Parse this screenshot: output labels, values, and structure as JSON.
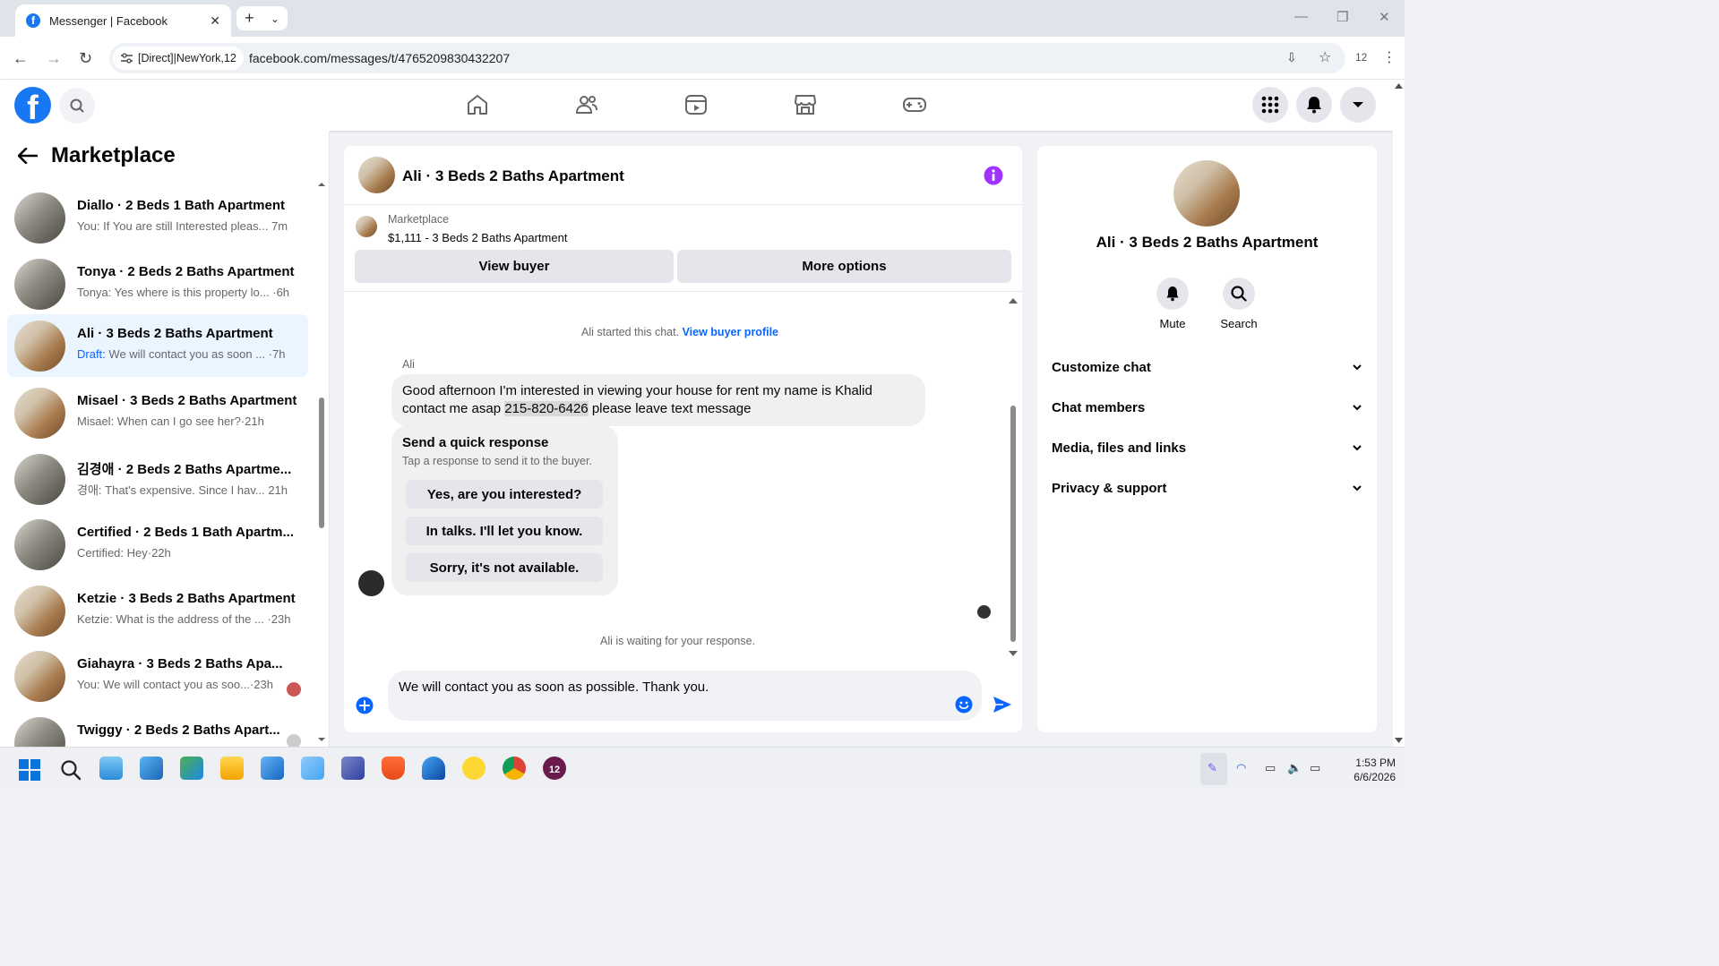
{
  "browser": {
    "tab_title": "Messenger | Facebook",
    "site_chip": "[Direct]|NewYork,12",
    "url": "facebook.com/messages/t/4765209830432207",
    "extension_count": "12"
  },
  "fb_header": {
    "logo": "f",
    "nav_icons": [
      "home-icon",
      "friends-icon",
      "video-icon",
      "marketplace-icon",
      "gaming-icon"
    ],
    "right_icons": [
      "menu-grid-icon",
      "notifications-bell-icon",
      "account-caret-icon"
    ]
  },
  "sidebar": {
    "title": "Marketplace",
    "conversations": [
      {
        "name": "Diallo · 2 Beds 1 Bath Apartment",
        "preview": "You: If You are still Interested pleas...",
        "time": "7m",
        "active": false
      },
      {
        "name": "Tonya · 2 Beds 2 Baths Apartment",
        "preview": "Tonya: Yes where is this property lo...",
        "time": "·6h",
        "active": false
      },
      {
        "name": "Ali · 3 Beds 2 Baths Apartment",
        "draft_label": "Draft:",
        "preview": " We will contact you as soon ...",
        "time": "·7h",
        "active": true
      },
      {
        "name": "Misael · 3 Beds 2 Baths Apartment",
        "preview": "Misael: When can I go see her?",
        "time": "·21h",
        "active": false
      },
      {
        "name": "김경애 · 2 Beds 2 Baths Apartme...",
        "preview": "경애: That's expensive. Since I hav...",
        "time": "21h",
        "active": false
      },
      {
        "name": "Certified · 2 Beds 1 Bath Apartm...",
        "preview": "Certified: Hey",
        "time": "·22h",
        "active": false
      },
      {
        "name": "Ketzie · 3 Beds 2 Baths Apartment",
        "preview": "Ketzie: What is the address of the ...",
        "time": "·23h",
        "active": false
      },
      {
        "name": "Giahayra · 3 Beds 2 Baths Apa...",
        "preview": "You: We will contact you as soo...",
        "time": "·23h",
        "active": false
      },
      {
        "name": "Twiggy · 2 Beds 2 Baths Apart...",
        "preview": "",
        "time": "",
        "active": false
      }
    ]
  },
  "chat": {
    "name": "Ali · 3 Beds 2 Baths Apartment",
    "marketplace_label": "Marketplace",
    "listing": "$1,111 - 3 Beds 2 Baths Apartment",
    "view_buyer": "View buyer",
    "more_options": "More options",
    "started_text": "Ali started this chat.",
    "view_buyer_profile": "View buyer profile",
    "sender": "Ali",
    "message_part1": "Good afternoon I'm interested in viewing your house for rent my name is Khalid contact me asap ",
    "message_phone": "215-820-6426",
    "message_part2": " please leave text message",
    "quick_response_title": "Send a quick response",
    "quick_response_sub": "Tap a response to send it to the buyer.",
    "quick_responses": [
      "Yes, are you interested?",
      "In talks. I'll let you know.",
      "Sorry, it's not available."
    ],
    "waiting_text": "Ali is waiting for your response.",
    "composer_text": "We will contact you as soon as possible. Thank you."
  },
  "details": {
    "name": "Ali · 3 Beds 2 Baths Apartment",
    "mute": "Mute",
    "search": "Search",
    "sections": [
      "Customize chat",
      "Chat members",
      "Media, files and links",
      "Privacy & support"
    ]
  },
  "taskbar": {
    "time": "1:53 PM",
    "date": "6/6/2026",
    "badge": "12"
  },
  "colors": {
    "fb_blue": "#1877f2",
    "link_blue": "#0866ff",
    "info_purple": "#a033ff"
  }
}
